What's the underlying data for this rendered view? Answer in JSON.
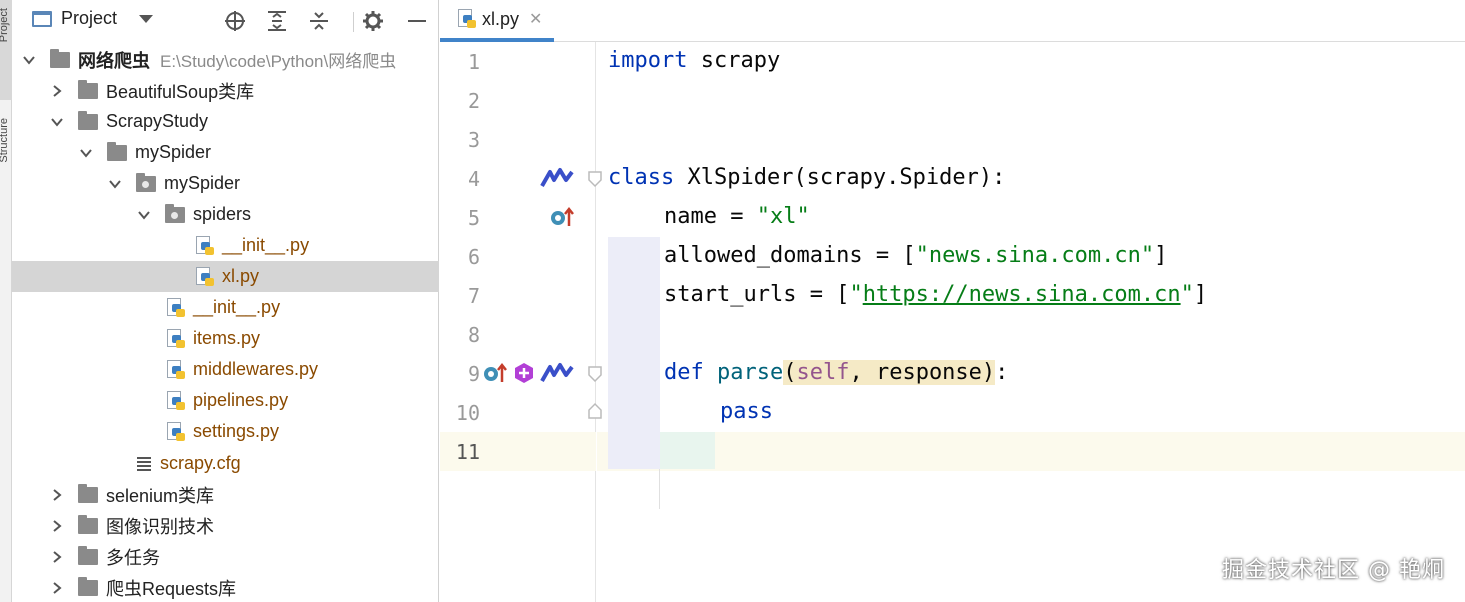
{
  "left_stripe": {
    "labels": [
      "Project",
      "Structure"
    ]
  },
  "project_panel": {
    "title": "Project",
    "toolbar_icons": [
      "locate-icon",
      "expand-all-icon",
      "collapse-all-icon",
      "gear-icon",
      "minimize-icon"
    ],
    "tree": [
      {
        "label": "网络爬虫",
        "path": "E:\\Study\\code\\Python\\网络爬虫",
        "type": "folder",
        "expanded": true
      },
      {
        "label": "BeautifulSoup类库",
        "type": "folder",
        "expanded": false
      },
      {
        "label": "ScrapyStudy",
        "type": "folder",
        "expanded": true
      },
      {
        "label": "mySpider",
        "type": "folder",
        "expanded": true
      },
      {
        "label": "mySpider",
        "type": "package",
        "expanded": true
      },
      {
        "label": "spiders",
        "type": "package",
        "expanded": true
      },
      {
        "label": "__init__.py",
        "type": "python"
      },
      {
        "label": "xl.py",
        "type": "python",
        "selected": true
      },
      {
        "label": "__init__.py",
        "type": "python"
      },
      {
        "label": "items.py",
        "type": "python"
      },
      {
        "label": "middlewares.py",
        "type": "python"
      },
      {
        "label": "pipelines.py",
        "type": "python"
      },
      {
        "label": "settings.py",
        "type": "python"
      },
      {
        "label": "scrapy.cfg",
        "type": "config"
      },
      {
        "label": "selenium类库",
        "type": "folder",
        "expanded": false
      },
      {
        "label": "图像识别技术",
        "type": "folder",
        "expanded": false
      },
      {
        "label": "多任务",
        "type": "folder",
        "expanded": false
      },
      {
        "label": "爬虫Requests库",
        "type": "folder",
        "expanded": false
      }
    ]
  },
  "editor": {
    "tab": {
      "label": "xl.py",
      "close": "✕"
    },
    "line_numbers": [
      "1",
      "2",
      "3",
      "4",
      "5",
      "6",
      "7",
      "8",
      "9",
      "10",
      "11"
    ],
    "current_line": "11",
    "code": {
      "l1_kw": "import",
      "l1_rest": " scrapy",
      "l4_kw": "class",
      "l4_rest": " XlSpider(scrapy.Spider):",
      "l5_a": "name = ",
      "l5_str": "\"xl\"",
      "l6_a": "allowed_domains = [",
      "l6_str": "\"news.sina.com.cn\"",
      "l6_b": "]",
      "l7_a": "start_urls = [",
      "l7_q1": "\"",
      "l7_url": "https://news.sina.com.cn",
      "l7_q2": "\"",
      "l7_b": "]",
      "l9_kw": "def",
      "l9_name": " parse",
      "l9_open": "(",
      "l9_self": "self",
      "l9_params": ", response)",
      "l9_colon": ":",
      "l10_kw": "pass"
    }
  },
  "watermark": "掘金技术社区 @ 艳炯",
  "colors": {
    "keyword": "#0033b3",
    "string": "#067d17",
    "self": "#94558d",
    "selection": "#d5d5d5",
    "tab_underline": "#4083c9",
    "current_line": "#fcfaed"
  }
}
